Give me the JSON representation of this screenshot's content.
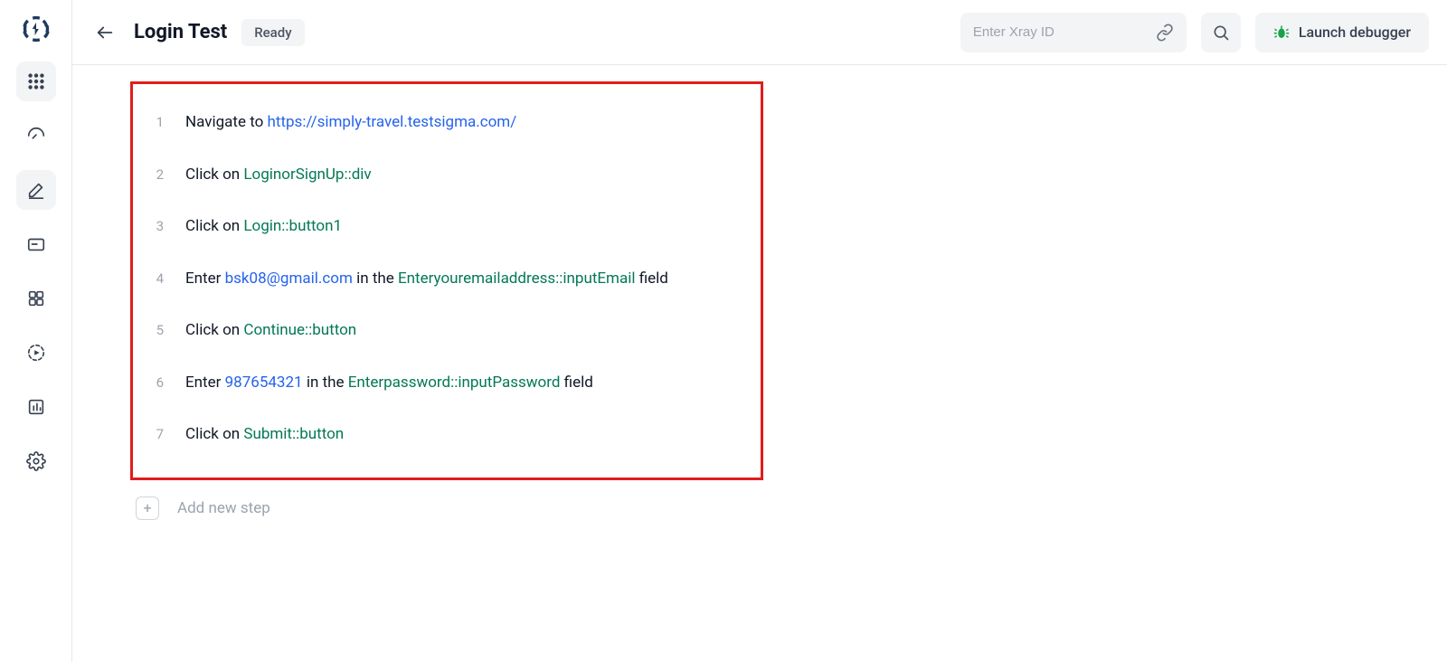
{
  "header": {
    "title": "Login Test",
    "status": "Ready",
    "xray_placeholder": "Enter Xray ID",
    "launch_label": "Launch debugger"
  },
  "add_step_label": "Add new step",
  "steps": [
    {
      "num": "1",
      "parts": [
        {
          "t": "plain",
          "v": "Navigate to "
        },
        {
          "t": "url",
          "v": "https://simply-travel.testsigma.com/"
        }
      ]
    },
    {
      "num": "2",
      "parts": [
        {
          "t": "plain",
          "v": "Click on "
        },
        {
          "t": "elem",
          "v": "LoginorSignUp::div"
        }
      ]
    },
    {
      "num": "3",
      "parts": [
        {
          "t": "plain",
          "v": "Click on "
        },
        {
          "t": "elem",
          "v": "Login::button1"
        }
      ]
    },
    {
      "num": "4",
      "parts": [
        {
          "t": "plain",
          "v": "Enter "
        },
        {
          "t": "val",
          "v": "bsk08@gmail.com"
        },
        {
          "t": "plain",
          "v": " in the "
        },
        {
          "t": "elem",
          "v": "Enteryouremailaddress::inputEmail"
        },
        {
          "t": "plain",
          "v": " field"
        }
      ]
    },
    {
      "num": "5",
      "parts": [
        {
          "t": "plain",
          "v": "Click on "
        },
        {
          "t": "elem",
          "v": "Continue::button"
        }
      ]
    },
    {
      "num": "6",
      "parts": [
        {
          "t": "plain",
          "v": "Enter "
        },
        {
          "t": "val",
          "v": "987654321"
        },
        {
          "t": "plain",
          "v": " in the "
        },
        {
          "t": "elem",
          "v": "Enterpassword::inputPassword"
        },
        {
          "t": "plain",
          "v": " field"
        }
      ]
    },
    {
      "num": "7",
      "parts": [
        {
          "t": "plain",
          "v": "Click on "
        },
        {
          "t": "elem",
          "v": "Submit::button"
        }
      ]
    }
  ]
}
